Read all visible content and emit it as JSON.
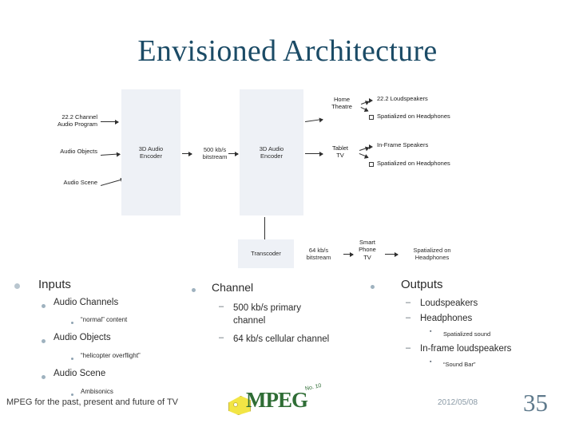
{
  "slide": {
    "title": "Envisioned Architecture",
    "footer_left": "MPEG for the past, present and future of TV",
    "footer_date": "2012/05/08",
    "page_number": "35",
    "logo": {
      "text": "MPEG",
      "superscript": "No. 10",
      "icon": "mpeg-tag-icon"
    }
  },
  "diagram": {
    "inputs": [
      "22.2 Channel\nAudio Program",
      "Audio Objects",
      "Audio Scene"
    ],
    "blocks": [
      {
        "name": "encoder-3d-audio",
        "label": "3D Audio\nEncoder"
      },
      {
        "name": "bitstream-500kbs",
        "label": "500 kb/s\nbitstream"
      },
      {
        "name": "encoder-3d-audio-2",
        "label": "3D Audio\nEncoder"
      },
      {
        "name": "transcoder",
        "label": "Transcoder"
      },
      {
        "name": "bitstream-64kbs",
        "label": "64 kb/s\nbitstream"
      }
    ],
    "devices": [
      {
        "name": "home-theatre",
        "label": "Home\nTheatre"
      },
      {
        "name": "tablet-tv",
        "label": "Tablet\nTV"
      },
      {
        "name": "smart-phone-tv",
        "label": "Smart\nPhone\nTV"
      }
    ],
    "outputs": [
      "22.2 Loudspeakers",
      "Spatialized on Headphones",
      "In-Frame Speakers",
      "Spatialized on Headphones",
      "Spatialized on\nHeadphones"
    ]
  },
  "columns": {
    "inputs": {
      "heading": "Inputs",
      "items": [
        {
          "label": "Audio Channels",
          "sub": [
            "“normal” content"
          ]
        },
        {
          "label": "Audio Objects",
          "sub": [
            "“helicopter overflight”"
          ]
        },
        {
          "label": "Audio Scene",
          "sub": [
            "Ambisonics"
          ]
        }
      ]
    },
    "channel": {
      "heading": "Channel",
      "items": [
        "500 kb/s primary channel",
        "64 kb/s cellular channel"
      ]
    },
    "outputs": {
      "heading": "Outputs",
      "items": [
        {
          "label": "Loudspeakers",
          "sub": []
        },
        {
          "label": "Headphones",
          "sub": [
            "Spatialized sound"
          ]
        },
        {
          "label": "In-frame loudspeakers",
          "sub": [
            "“Sound Bar”"
          ]
        }
      ]
    }
  },
  "colors": {
    "title": "#1b4b66",
    "block_fill": "#eef1f6",
    "page_number": "#5f7a8c",
    "logo_green": "#2f6d35",
    "logo_yellow": "#f2e545"
  }
}
